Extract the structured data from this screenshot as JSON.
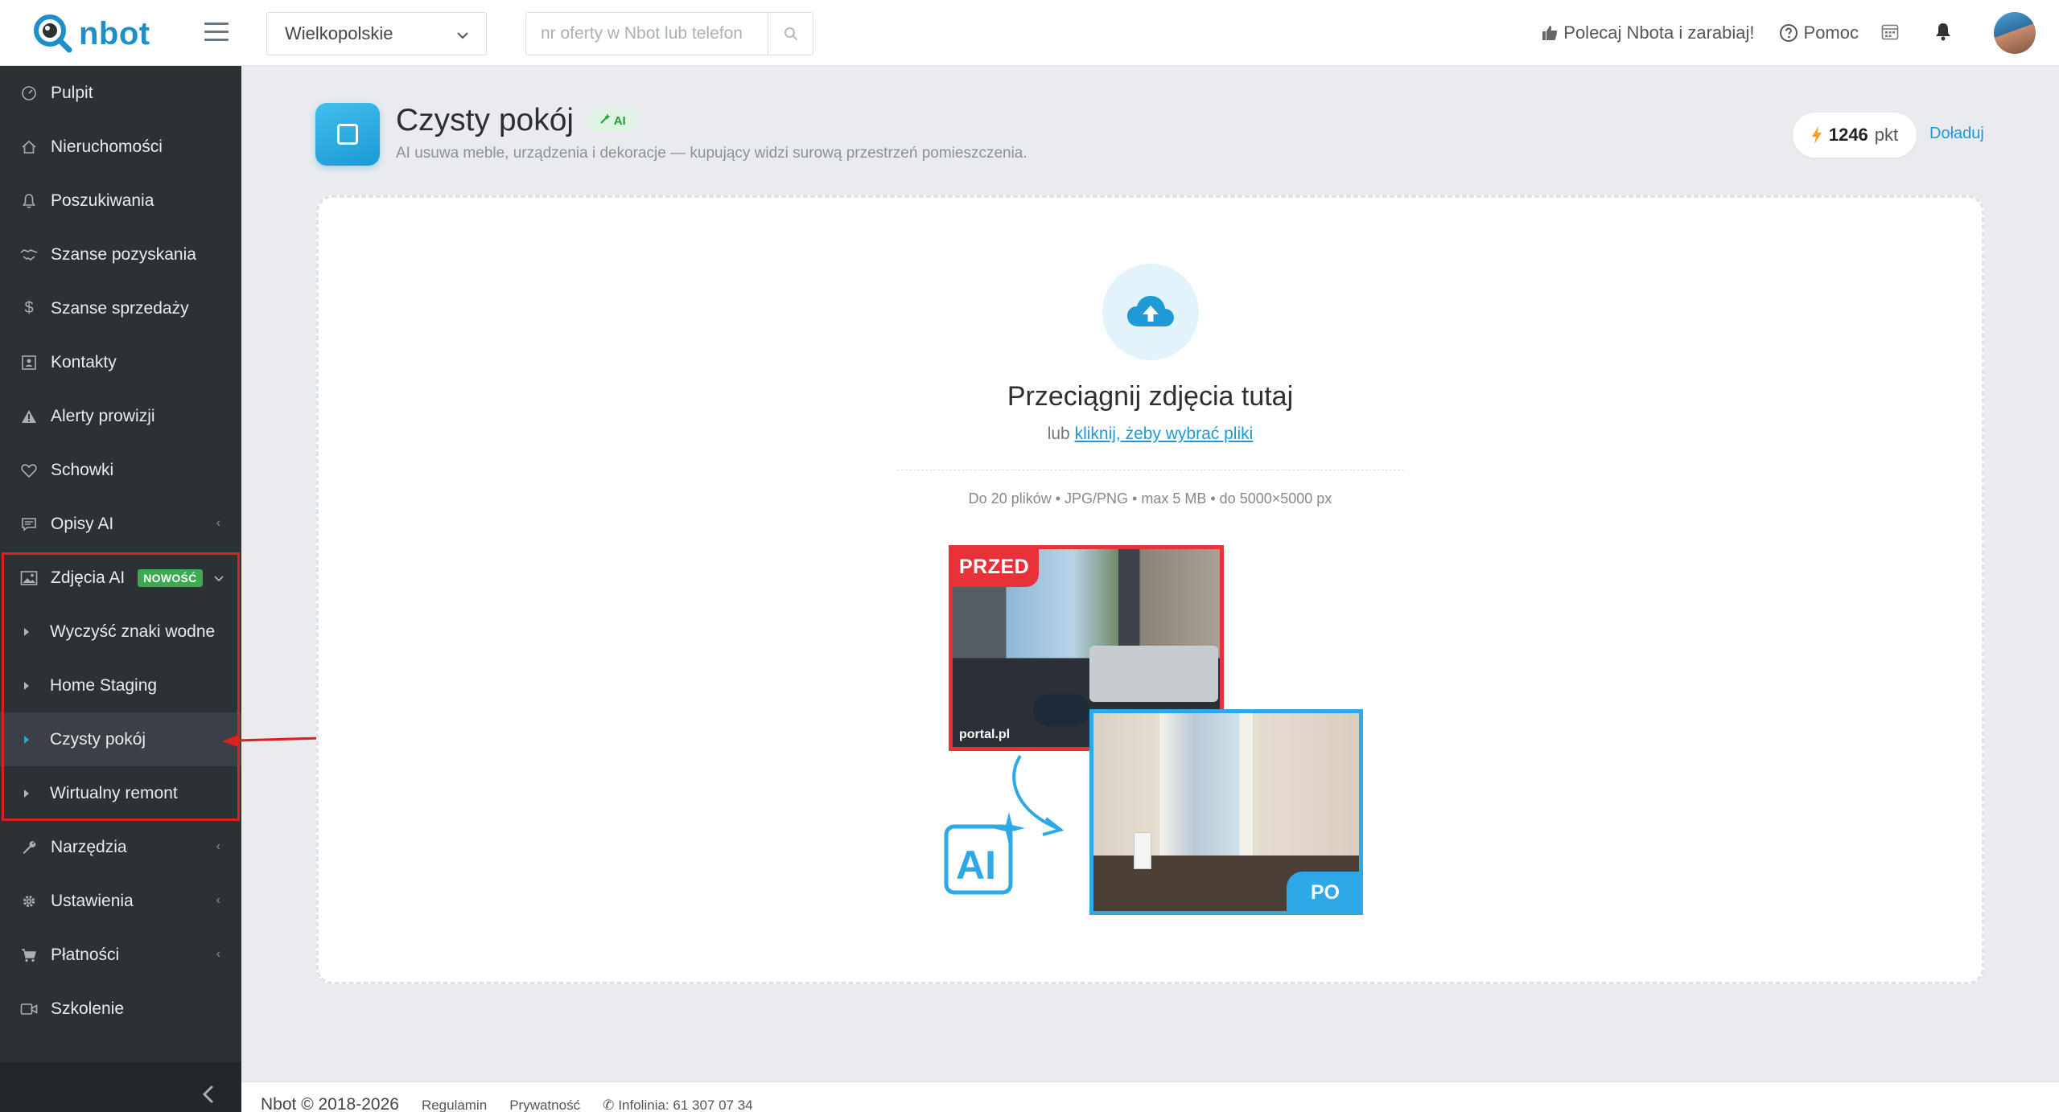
{
  "header": {
    "logo_text": "nbot",
    "region_selected": "Wielkopolskie",
    "search_placeholder": "nr oferty w Nbot lub telefon",
    "refer_label": "Polecaj Nbota i zarabiaj!",
    "help_label": "Pomoc"
  },
  "sidebar": {
    "items": [
      {
        "label": "Pulpit",
        "icon": "gauge-icon"
      },
      {
        "label": "Nieruchomości",
        "icon": "home-icon"
      },
      {
        "label": "Poszukiwania",
        "icon": "bell-icon"
      },
      {
        "label": "Szanse pozyskania",
        "icon": "handshake-icon"
      },
      {
        "label": "Szanse sprzedaży",
        "icon": "dollar-icon"
      },
      {
        "label": "Kontakty",
        "icon": "contact-card-icon"
      },
      {
        "label": "Alerty prowizji",
        "icon": "warning-icon"
      },
      {
        "label": "Schowki",
        "icon": "heart-icon"
      },
      {
        "label": "Opisy AI",
        "icon": "chat-icon"
      },
      {
        "label": "Zdjęcia AI",
        "icon": "image-icon",
        "badge": "NOWOŚĆ"
      },
      {
        "label": "Narzędzia",
        "icon": "wrench-icon"
      },
      {
        "label": "Ustawienia",
        "icon": "gear-icon"
      },
      {
        "label": "Płatności",
        "icon": "cart-icon"
      },
      {
        "label": "Szkolenie",
        "icon": "video-icon"
      }
    ],
    "subitems": [
      {
        "label": "Wyczyść znaki wodne"
      },
      {
        "label": "Home Staging"
      },
      {
        "label": "Czysty pokój",
        "active": true
      },
      {
        "label": "Wirtualny remont"
      }
    ]
  },
  "page": {
    "title": "Czysty pokój",
    "ai_badge": "AI",
    "subtitle": "AI usuwa meble, urządzenia i dekoracje — kupujący widzi surową przestrzeń pomieszczenia.",
    "points_value": "1246",
    "points_unit": "pkt",
    "topup_label": "Doładuj"
  },
  "dropzone": {
    "title": "Przeciągnij zdjęcia tutaj",
    "sub_prefix": "lub",
    "sub_link": "kliknij, żeby wybrać pliki",
    "limits": "Do 20 plików • JPG/PNG • max 5 MB • do 5000×5000 px"
  },
  "illustration": {
    "before_label": "PRZED",
    "watermark": "portal.pl",
    "after_label": "PO",
    "ai_text": "AI"
  },
  "footer": {
    "copyright": "Nbot © 2018-2026",
    "terms": "Regulamin",
    "privacy": "Prywatność",
    "phone": "Infolinia: 61 307 07 34"
  },
  "colors": {
    "brand": "#1d8fc9",
    "sidebar": "#2c3136",
    "accent": "#1d9ad6",
    "before": "#e8323a",
    "after": "#2ea8e6",
    "annotation": "#e02020"
  }
}
